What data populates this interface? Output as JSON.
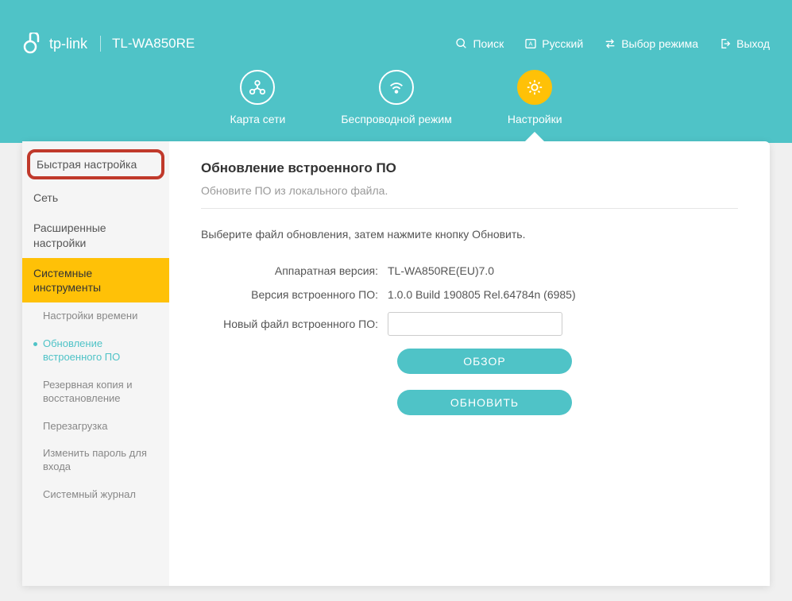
{
  "header": {
    "brand": "tp-link",
    "model": "TL-WA850RE",
    "actions": {
      "search": "Поиск",
      "language": "Русский",
      "mode": "Выбор режима",
      "logout": "Выход"
    }
  },
  "tabs": {
    "network_map": "Карта сети",
    "wireless": "Беспроводной режим",
    "settings": "Настройки"
  },
  "sidebar": {
    "quick_setup": "Быстрая настройка",
    "network": "Сеть",
    "advanced": "Расширенные настройки",
    "system_tools": "Системные инструменты",
    "subs": {
      "time": "Настройки времени",
      "firmware": "Обновление встроенного ПО",
      "backup": "Резервная копия и восстановление",
      "reboot": "Перезагрузка",
      "password": "Изменить пароль для входа",
      "syslog": "Системный журнал"
    }
  },
  "content": {
    "title": "Обновление встроенного ПО",
    "subtitle": "Обновите ПО из локального файла.",
    "instruction": "Выберите файл обновления, затем нажмите кнопку Обновить.",
    "hw_label": "Аппаратная версия:",
    "hw_value": "TL-WA850RE(EU)7.0",
    "fw_label": "Версия встроенного ПО:",
    "fw_value": "1.0.0 Build 190805 Rel.64784n (6985)",
    "file_label": "Новый файл встроенного ПО:",
    "browse": "ОБЗОР",
    "update": "ОБНОВИТЬ"
  }
}
